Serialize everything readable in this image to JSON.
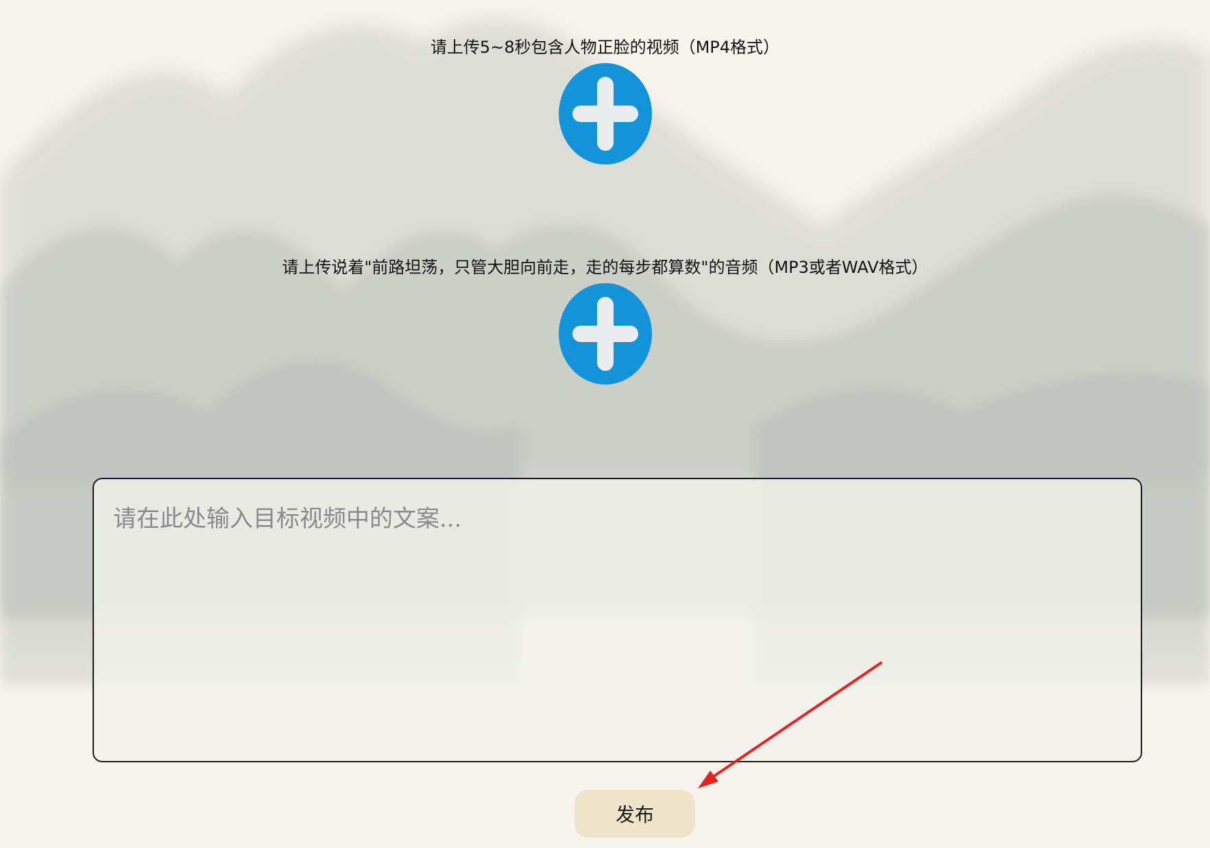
{
  "upload_video": {
    "label": "请上传5~8秒包含人物正脸的视频（MP4格式）",
    "icon": "plus-circle-icon"
  },
  "upload_audio": {
    "label": "请上传说着\"前路坦荡，只管大胆向前走，走的每步都算数\"的音频（MP3或者WAV格式）",
    "icon": "plus-circle-icon"
  },
  "caption": {
    "placeholder": "请在此处输入目标视频中的文案...",
    "value": ""
  },
  "publish_label": "发布",
  "colors": {
    "accent": "#1393da",
    "publish_bg": "#efe3c9",
    "annotation_arrow": "#e8231f",
    "page_bg": "#f7f4ee"
  }
}
